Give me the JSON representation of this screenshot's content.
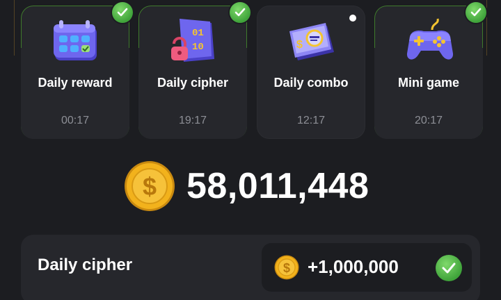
{
  "daily_tasks": [
    {
      "title": "Daily reward",
      "time": "00:17",
      "status": "completed",
      "icon": "calendar-icon"
    },
    {
      "title": "Daily cipher",
      "time": "19:17",
      "status": "completed",
      "icon": "cipher-lock-icon"
    },
    {
      "title": "Daily combo",
      "time": "12:17",
      "status": "new",
      "icon": "combo-card-icon"
    },
    {
      "title": "Mini game",
      "time": "20:17",
      "status": "completed",
      "icon": "gamepad-icon"
    }
  ],
  "balance": {
    "value": "58,011,448",
    "icon": "coin-icon"
  },
  "cipher_bar": {
    "title": "Daily cipher",
    "reward": "+1,000,000",
    "status": "completed"
  },
  "colors": {
    "background": "#1c1d21",
    "card": "#26272c",
    "check_green": "#3fa33a",
    "coin_gold": "#f2b21c",
    "accent_purple": "#6b63e6"
  }
}
